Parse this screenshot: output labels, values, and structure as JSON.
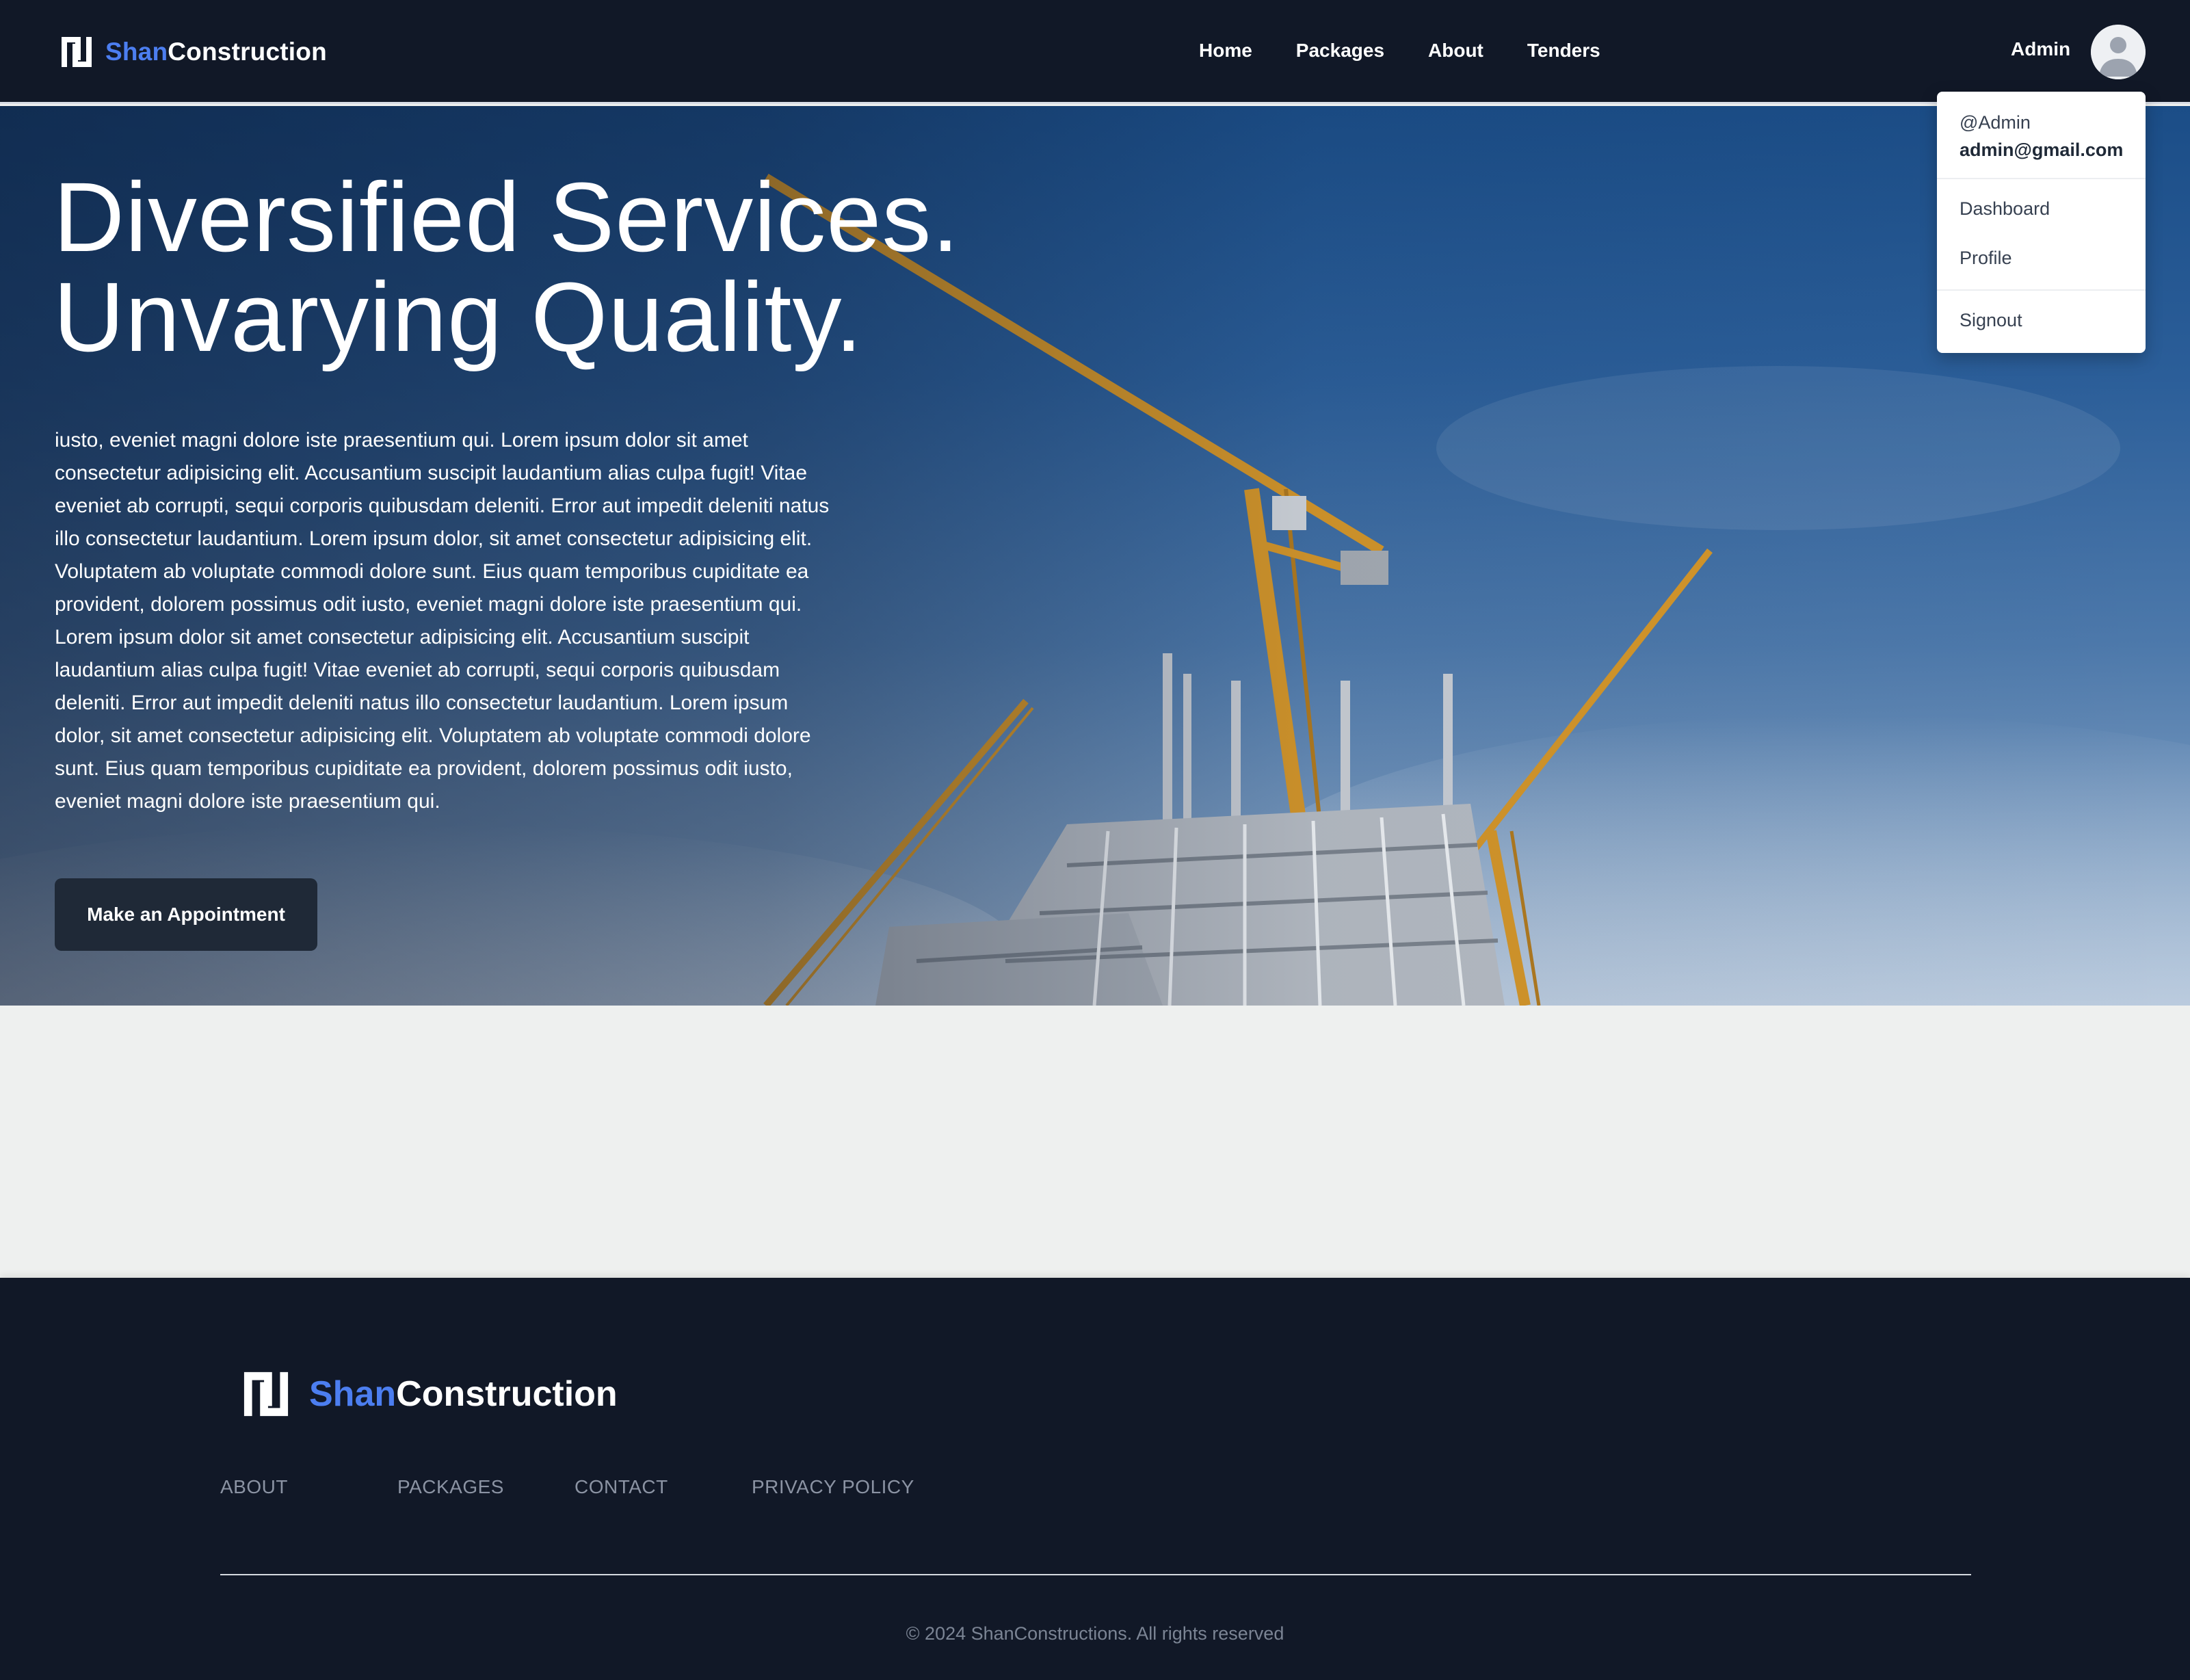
{
  "brand": {
    "name_highlight": "Shan",
    "name_rest": "Construction"
  },
  "nav": {
    "links": [
      {
        "label": "Home"
      },
      {
        "label": "Packages"
      },
      {
        "label": "About"
      },
      {
        "label": "Tenders"
      }
    ],
    "user_label": "Admin"
  },
  "user_menu": {
    "handle": "@Admin",
    "email": "admin@gmail.com",
    "items": [
      {
        "label": "Dashboard"
      },
      {
        "label": "Profile"
      },
      {
        "label": "Signout"
      }
    ]
  },
  "hero": {
    "title_line1": "Diversified Services.",
    "title_line2": "Unvarying Quality.",
    "body": "iusto, eveniet magni dolore iste praesentium qui. Lorem ipsum dolor sit amet consectetur adipisicing elit. Accusantium suscipit laudantium alias culpa fugit! Vitae eveniet ab corrupti, sequi corporis quibusdam deleniti. Error aut impedit deleniti natus illo consectetur laudantium. Lorem ipsum dolor, sit amet consectetur adipisicing elit. Voluptatem ab voluptate commodi dolore sunt. Eius quam temporibus cupiditate ea provident, dolorem possimus odit iusto, eveniet magni dolore iste praesentium qui. Lorem ipsum dolor sit amet consectetur adipisicing elit. Accusantium suscipit laudantium alias culpa fugit! Vitae eveniet ab corrupti, sequi corporis quibusdam deleniti. Error aut impedit deleniti natus illo consectetur laudantium. Lorem ipsum dolor, sit amet consectetur adipisicing elit. Voluptatem ab voluptate commodi dolore sunt. Eius quam temporibus cupiditate ea provident, dolorem possimus odit iusto, eveniet magni dolore iste praesentium qui.",
    "cta_label": "Make an Appointment"
  },
  "footer": {
    "links": [
      {
        "label": "ABOUT"
      },
      {
        "label": "PACKAGES"
      },
      {
        "label": "CONTACT"
      },
      {
        "label": "PRIVACY POLICY"
      }
    ],
    "copyright": "© 2024 ShanConstructions. All rights reserved"
  },
  "colors": {
    "nav_background": "#111827",
    "brand_accent": "#4c7ef0",
    "button_background": "#1f2937",
    "page_background": "#eef0ef",
    "footer_link": "#8b93a3"
  },
  "icons": {
    "logo": "interlocking-square-logo-icon",
    "avatar": "user-avatar-icon"
  }
}
